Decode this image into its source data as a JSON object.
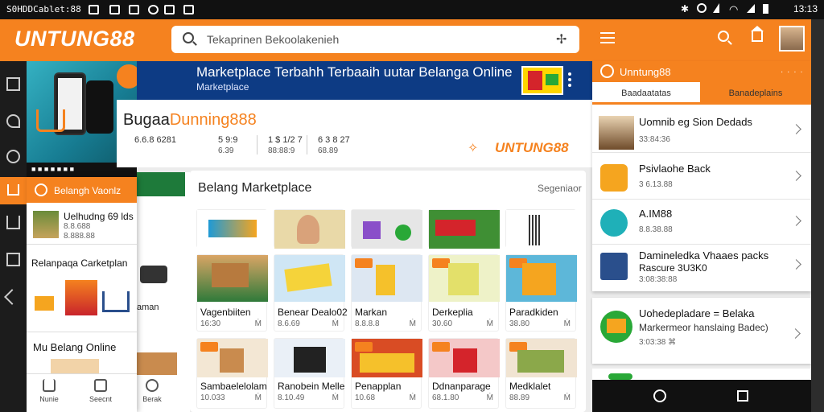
{
  "status_bar": {
    "left_text": "S0HDDCablet:88",
    "time": "13:13"
  },
  "app": {
    "logo": "UNTUNG88"
  },
  "search": {
    "query": "Tekaprinen Bekoolakenieh"
  },
  "banner": {
    "title": "Marketplace Terbahh Terbaaih uutar Belanga Online",
    "subtitle": "Marketplace"
  },
  "store": {
    "name_prefix": "Bugaa",
    "name_suffix": "Dunning888",
    "brand": "UNTUNG88",
    "stats": [
      {
        "value": "6.6.8 6281",
        "label": ""
      },
      {
        "value": "5 9:9",
        "label": "6.39"
      },
      {
        "value": "1 $ 1/2 7",
        "label": "88:88:9"
      },
      {
        "value": "6 3 8 27",
        "label": "68.89"
      }
    ]
  },
  "left_panel": {
    "header": "Belangh Vaonlz",
    "items": [
      {
        "title": "Uelhudng 69 lds",
        "sub1": "8.8.688",
        "sub2": "8.888.88"
      },
      {
        "title": "Relanpaqa Carketplan",
        "sub1": "",
        "sub2": ""
      },
      {
        "title": "Mu Belang Online",
        "sub1": "",
        "sub2": ""
      }
    ],
    "partial_text": "aman",
    "strip_text": "■ ■ ■ ■ ■ ■ ■"
  },
  "main": {
    "title": "Belang Marketplace",
    "more": "Segeniaor",
    "row1": [
      {
        "name": "",
        "color": "#ffffff"
      },
      {
        "name": "",
        "color": "#e9d9a8"
      },
      {
        "name": "",
        "color": "#e6e6e6"
      },
      {
        "name": "",
        "color": "#3f8f34"
      },
      {
        "name": "",
        "color": "#ffffff"
      }
    ],
    "row2": [
      {
        "name": "Vagenbiiten",
        "price": "16:30",
        "act": "Ṁ"
      },
      {
        "name": "Benear Dealo02",
        "price": "8.6.69",
        "act": "Ṁ"
      },
      {
        "name": "Markan",
        "price": "8.8.8.8",
        "act": "Ṁ"
      },
      {
        "name": "Derkeplia",
        "price": "30.60",
        "act": "Ṁ"
      },
      {
        "name": "Paradkiden",
        "price": "38.80",
        "act": "Ṁ"
      }
    ],
    "row3": [
      {
        "name": "Sambaelelolam",
        "price": "10.033",
        "act": "Ṁ"
      },
      {
        "name": "Ranobein Melle",
        "price": "8.10.49",
        "act": "Ṁ"
      },
      {
        "name": "Penapplan",
        "price": "10.68",
        "act": "Ṁ"
      },
      {
        "name": "Ddnanparage",
        "price": "68.1.80",
        "act": "Ṁ"
      },
      {
        "name": "Medklalet",
        "price": "88.89",
        "act": "Ṁ"
      }
    ]
  },
  "right_panel": {
    "header": "Unntung88",
    "tabs": [
      "Baadaatatas",
      "Banadeplains"
    ],
    "rows": [
      {
        "name": "Uomnib eg Sion Dedads",
        "sub": "33:84:36",
        "color": "#c49a55"
      },
      {
        "name": "Psivlaohe Back",
        "sub": "3 6.13.88",
        "color": "#f5a51f"
      },
      {
        "name": "A.IM88",
        "sub": "8.8.38.88",
        "color": "#1fb0b8"
      },
      {
        "name": "Damineledka Vhaaes packs",
        "sub2": "Rascure 3U3K0",
        "sub": "3:08:38:88",
        "color": "#2a4f8c"
      }
    ],
    "card": {
      "title": "Uohedepladare = Belaka",
      "sub": "Markermeor hanslaing Badec)",
      "meta": "3:03:38 ⌘"
    }
  },
  "bottom_nav": {
    "items": [
      {
        "label": "Nunie"
      },
      {
        "label": "Seecnt"
      },
      {
        "label": "Berak"
      }
    ]
  }
}
